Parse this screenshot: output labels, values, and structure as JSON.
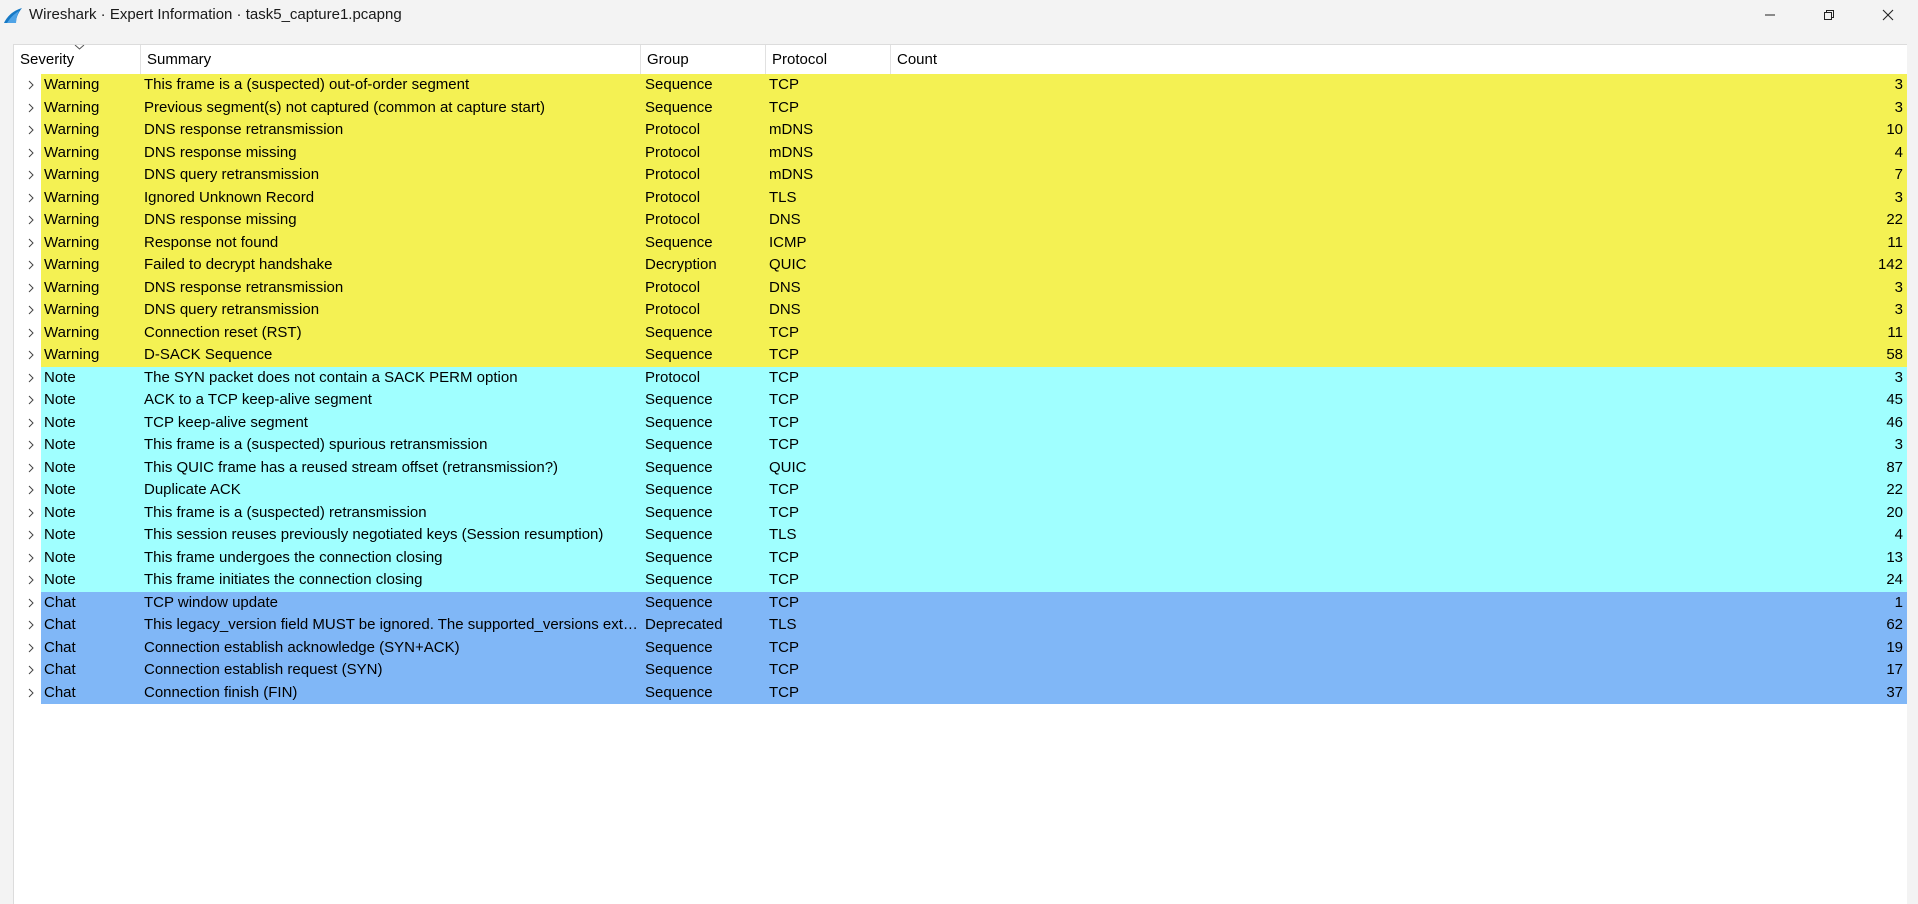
{
  "window": {
    "title": "Wireshark · Expert Information · task5_capture1.pcapng",
    "icon": "wireshark-fin-icon",
    "controls": [
      "minimize-icon",
      "restore-icon",
      "close-icon"
    ]
  },
  "colors": {
    "warning": "#f4f153",
    "note": "#a0ffff",
    "chat": "#80b7f7"
  },
  "table": {
    "columns": [
      "Severity",
      "Summary",
      "Group",
      "Protocol",
      "Count"
    ],
    "sort_column": "Severity",
    "rows": [
      {
        "severity": "Warning",
        "summary": "This frame is a (suspected) out-of-order segment",
        "group": "Sequence",
        "protocol": "TCP",
        "count": "3"
      },
      {
        "severity": "Warning",
        "summary": "Previous segment(s) not captured (common at capture start)",
        "group": "Sequence",
        "protocol": "TCP",
        "count": "3"
      },
      {
        "severity": "Warning",
        "summary": "DNS response retransmission",
        "group": "Protocol",
        "protocol": "mDNS",
        "count": "10"
      },
      {
        "severity": "Warning",
        "summary": "DNS response missing",
        "group": "Protocol",
        "protocol": "mDNS",
        "count": "4"
      },
      {
        "severity": "Warning",
        "summary": "DNS query retransmission",
        "group": "Protocol",
        "protocol": "mDNS",
        "count": "7"
      },
      {
        "severity": "Warning",
        "summary": "Ignored Unknown Record",
        "group": "Protocol",
        "protocol": "TLS",
        "count": "3"
      },
      {
        "severity": "Warning",
        "summary": "DNS response missing",
        "group": "Protocol",
        "protocol": "DNS",
        "count": "22"
      },
      {
        "severity": "Warning",
        "summary": "Response not found",
        "group": "Sequence",
        "protocol": "ICMP",
        "count": "11"
      },
      {
        "severity": "Warning",
        "summary": "Failed to decrypt handshake",
        "group": "Decryption",
        "protocol": "QUIC",
        "count": "142"
      },
      {
        "severity": "Warning",
        "summary": "DNS response retransmission",
        "group": "Protocol",
        "protocol": "DNS",
        "count": "3"
      },
      {
        "severity": "Warning",
        "summary": "DNS query retransmission",
        "group": "Protocol",
        "protocol": "DNS",
        "count": "3"
      },
      {
        "severity": "Warning",
        "summary": "Connection reset (RST)",
        "group": "Sequence",
        "protocol": "TCP",
        "count": "11"
      },
      {
        "severity": "Warning",
        "summary": "D-SACK Sequence",
        "group": "Sequence",
        "protocol": "TCP",
        "count": "58"
      },
      {
        "severity": "Note",
        "summary": "The SYN packet does not contain a SACK PERM option",
        "group": "Protocol",
        "protocol": "TCP",
        "count": "3"
      },
      {
        "severity": "Note",
        "summary": "ACK to a TCP keep-alive segment",
        "group": "Sequence",
        "protocol": "TCP",
        "count": "45"
      },
      {
        "severity": "Note",
        "summary": "TCP keep-alive segment",
        "group": "Sequence",
        "protocol": "TCP",
        "count": "46"
      },
      {
        "severity": "Note",
        "summary": "This frame is a (suspected) spurious retransmission",
        "group": "Sequence",
        "protocol": "TCP",
        "count": "3"
      },
      {
        "severity": "Note",
        "summary": "This QUIC frame has a reused stream offset (retransmission?)",
        "group": "Sequence",
        "protocol": "QUIC",
        "count": "87"
      },
      {
        "severity": "Note",
        "summary": "Duplicate ACK",
        "group": "Sequence",
        "protocol": "TCP",
        "count": "22"
      },
      {
        "severity": "Note",
        "summary": "This frame is a (suspected) retransmission",
        "group": "Sequence",
        "protocol": "TCP",
        "count": "20"
      },
      {
        "severity": "Note",
        "summary": "This session reuses previously negotiated keys (Session resumption)",
        "group": "Sequence",
        "protocol": "TLS",
        "count": "4"
      },
      {
        "severity": "Note",
        "summary": "This frame undergoes the connection closing",
        "group": "Sequence",
        "protocol": "TCP",
        "count": "13"
      },
      {
        "severity": "Note",
        "summary": "This frame initiates the connection closing",
        "group": "Sequence",
        "protocol": "TCP",
        "count": "24"
      },
      {
        "severity": "Chat",
        "summary": "TCP window update",
        "group": "Sequence",
        "protocol": "TCP",
        "count": "1"
      },
      {
        "severity": "Chat",
        "summary": "This legacy_version field MUST be ignored. The supported_versions exte...",
        "group": "Deprecated",
        "protocol": "TLS",
        "count": "62"
      },
      {
        "severity": "Chat",
        "summary": "Connection establish acknowledge (SYN+ACK)",
        "group": "Sequence",
        "protocol": "TCP",
        "count": "19"
      },
      {
        "severity": "Chat",
        "summary": "Connection establish request (SYN)",
        "group": "Sequence",
        "protocol": "TCP",
        "count": "17"
      },
      {
        "severity": "Chat",
        "summary": "Connection finish (FIN)",
        "group": "Sequence",
        "protocol": "TCP",
        "count": "37"
      }
    ]
  }
}
